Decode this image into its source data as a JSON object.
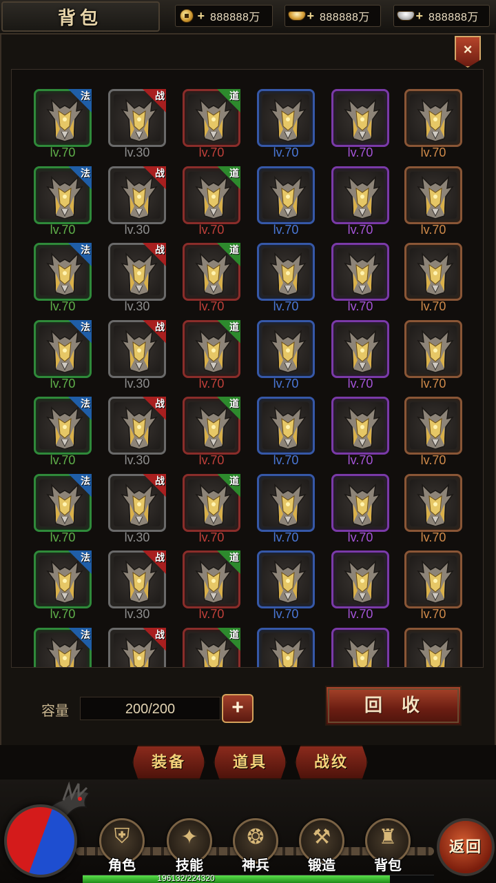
{
  "header": {
    "title": "背包",
    "currencies": [
      {
        "icon": "gold-coin-icon",
        "value": "888888万"
      },
      {
        "icon": "gold-ingot-icon",
        "value": "888888万"
      },
      {
        "icon": "silver-ingot-icon",
        "value": "888888万"
      }
    ],
    "close_label": "×"
  },
  "inventory": {
    "columns": [
      {
        "quality": "green",
        "tag": "法",
        "tag_color": "#1f5ea8",
        "level": "lv.70",
        "level_color": "#5fb04a"
      },
      {
        "quality": "gray",
        "tag": "战",
        "tag_color": "#a81f1f",
        "level": "lv.30",
        "level_color": "#8e8e8e"
      },
      {
        "quality": "red",
        "tag": "道",
        "tag_color": "#2d8a2d",
        "level": "lv.70",
        "level_color": "#c0403a"
      },
      {
        "quality": "blue",
        "tag": "",
        "tag_color": "",
        "level": "lv.70",
        "level_color": "#4a78d8"
      },
      {
        "quality": "purple",
        "tag": "",
        "tag_color": "",
        "level": "lv.70",
        "level_color": "#a454d8"
      },
      {
        "quality": "orange",
        "tag": "",
        "tag_color": "",
        "level": "lv.70",
        "level_color": "#d08a4a"
      }
    ],
    "rows": 8,
    "item_icon": "armor-icon"
  },
  "capacity": {
    "label": "容量",
    "value": "200/200",
    "add_label": "+"
  },
  "recycle_label": "回收",
  "tabs": [
    "装备",
    "道具",
    "战纹"
  ],
  "nav": [
    {
      "label": "角色",
      "icon": "armor-icon",
      "glyph": "⛨"
    },
    {
      "label": "技能",
      "icon": "skill-book-icon",
      "glyph": "✦"
    },
    {
      "label": "神兵",
      "icon": "divine-weapon-icon",
      "glyph": "❂"
    },
    {
      "label": "锻造",
      "icon": "anvil-icon",
      "glyph": "⚒"
    },
    {
      "label": "背包",
      "icon": "bag-icon",
      "glyph": "♜"
    }
  ],
  "return_label": "返回",
  "exp": {
    "text": "196132/224320",
    "fraction": 0.874
  }
}
